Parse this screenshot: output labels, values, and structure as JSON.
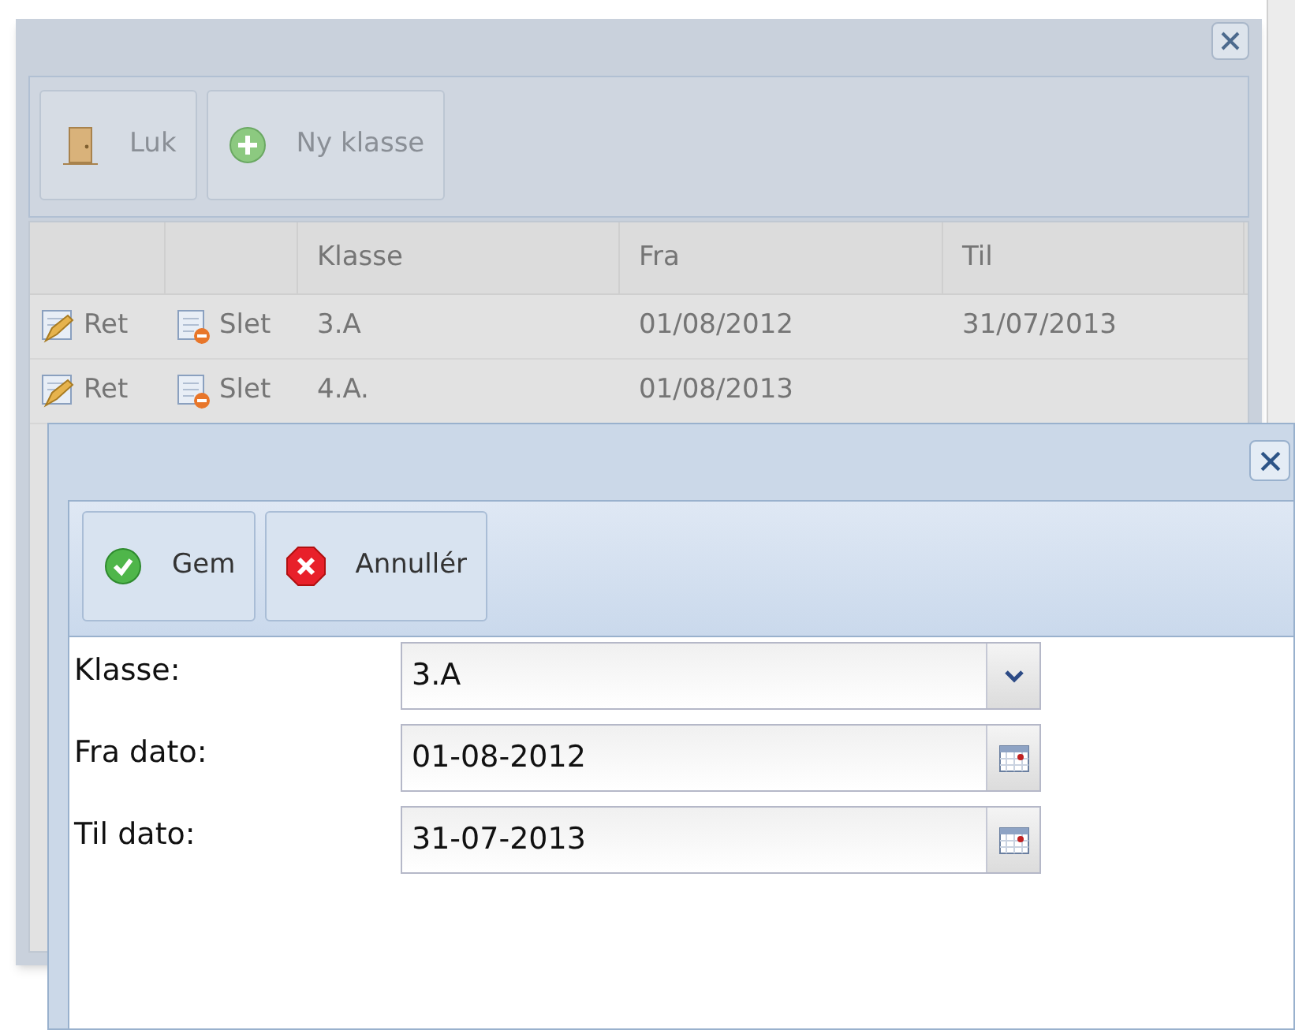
{
  "back_window": {
    "toolbar": [
      {
        "kind": "door",
        "label": "Luk"
      },
      {
        "kind": "add",
        "label": "Ny klasse"
      }
    ],
    "table": {
      "columns": [
        "",
        "",
        "Klasse",
        "Fra",
        "Til"
      ],
      "rows": [
        {
          "edit": "Ret",
          "delete": "Slet",
          "klasse": "3.A",
          "fra": "01/08/2012",
          "til": "31/07/2013"
        },
        {
          "edit": "Ret",
          "delete": "Slet",
          "klasse": "4.A.",
          "fra": "01/08/2013",
          "til": ""
        }
      ]
    }
  },
  "dialog": {
    "toolbar": [
      {
        "kind": "save",
        "label": "Gem"
      },
      {
        "kind": "cancel",
        "label": "Annullér"
      }
    ],
    "fields": [
      {
        "kind": "combo",
        "label": "Klasse:",
        "value": "3.A"
      },
      {
        "kind": "date",
        "label": "Fra dato:",
        "value": "01-08-2012"
      },
      {
        "kind": "date",
        "label": "Til dato:",
        "value": "31-07-2013"
      }
    ]
  }
}
